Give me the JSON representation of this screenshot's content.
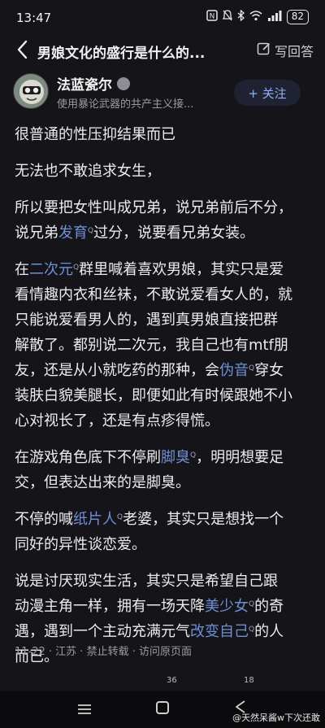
{
  "status": {
    "time": "13:47",
    "battery": "82",
    "icons": [
      "nfc-icon",
      "mute-icon",
      "bluetooth-icon",
      "wifi-icon",
      "signal-icon",
      "battery-icon"
    ]
  },
  "header": {
    "title": "男娘文化的盛行是什么的...",
    "write_label": "写回答"
  },
  "author": {
    "name": "法蓝瓷尔",
    "desc": "使用暴论武器的共产主义接...",
    "follow_label": "+ 关注"
  },
  "answer": {
    "p1": "很普通的性压抑结果而已",
    "p2": "无法也不敢追求女生，",
    "p3_l1": "所以要把女性叫成兄弟，说兄弟前后不分，",
    "p3_l2a": "说兄弟",
    "p3_kw1": "发育",
    "p3_l2b": "过分，说要看兄弟女装。",
    "p4_l1a": "在",
    "p4_kw1": "二次元",
    "p4_l1b": "群里喊着喜欢男娘，其实只是爱",
    "p4_l2": "看情趣内衣和丝袜，不敢说爱看女人的，就",
    "p4_l3": "只能说爱看男人的，遇到真男娘直接把群",
    "p4_l4": "解散了。都别说二次元，我自己也有mtf朋",
    "p4_l5a": "友，还是从小就吃药的那种，会",
    "p4_kw2": "伪音",
    "p4_l5b": "穿女",
    "p4_l6": "装肤白貌美腿长，即便如此有时候跟她不小",
    "p4_l7": "心对视长了，还是有点疹得慌。",
    "p5_l1a": "在游戏角色底下不停刷",
    "p5_kw1": "脚臭",
    "p5_l1b": "，明明想要足",
    "p5_l2": "交，但表达出来的是脚臭。",
    "p6_l1a": "不停的喊",
    "p6_kw1": "纸片人",
    "p6_l1b": "老婆，其实只是想找一个",
    "p6_l2": "同好的异性谈恋爱。",
    "p7_l1": "说是讨厌现实生活，其实只是希望自己跟",
    "p7_l2a": "动漫主角一样，拥有一场天降",
    "p7_kw1": "美少女",
    "p7_l2b": "的奇",
    "p7_l3a": "遇，遇到一个主动充满元气",
    "p7_kw2": "改变自己",
    "p7_l3b": "的人",
    "p7_l4": "而已。",
    "kw_mark": "Q"
  },
  "meta": "11-22 · 江苏 · 禁止转载 · 访问原页面",
  "actions": {
    "count1": "36",
    "count2": "18"
  },
  "watermark": "@天然呆酱w下次还敢"
}
